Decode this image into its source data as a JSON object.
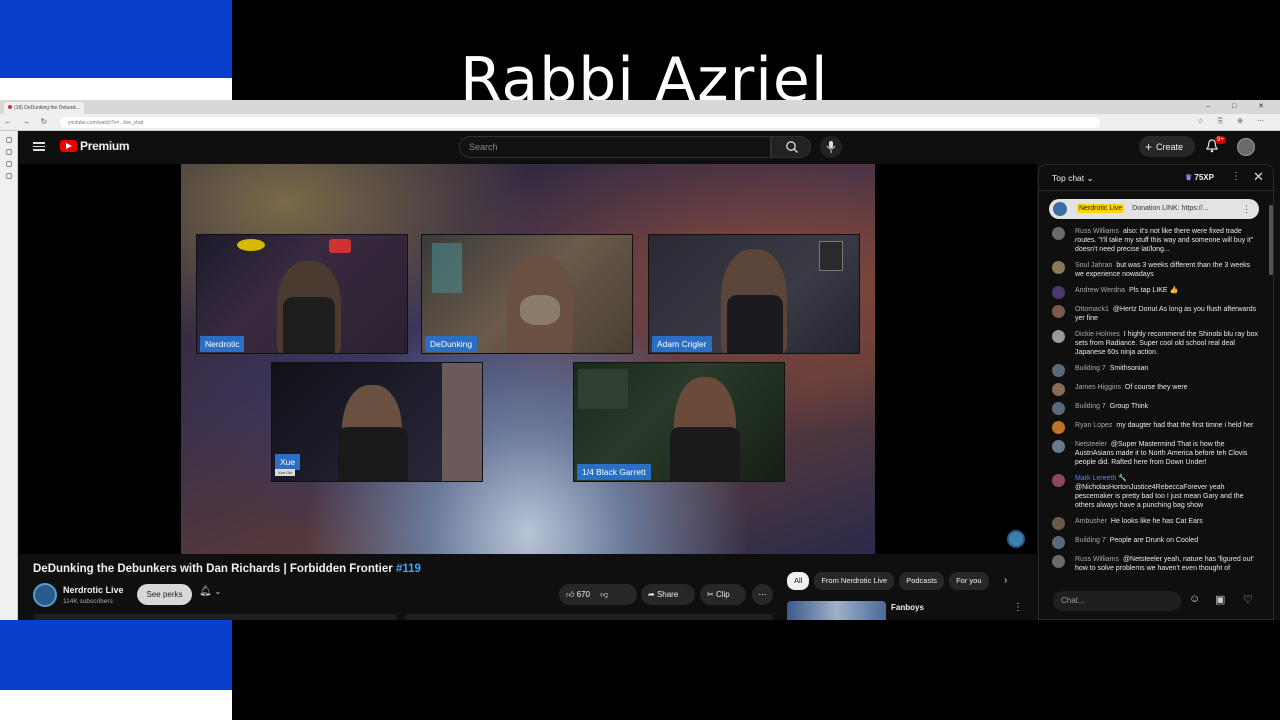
{
  "overlay": {
    "title": "Rabbi Azriel"
  },
  "browser": {
    "tab_title": "(18) DeDunking the Debunk...",
    "url": "youtube.com/watch?v=...live_chat",
    "nav_icons": "← → ↻",
    "toolbar_icons": "☆ ⎘ ⊕ ⋯",
    "window_controls": "– □ ✕"
  },
  "youtube": {
    "logo_text": "Premium",
    "search_placeholder": "Search",
    "create_label": "Create",
    "notification_badge": "9+"
  },
  "video": {
    "participants": [
      {
        "name": "Nerdrotic"
      },
      {
        "name": "DeDunking"
      },
      {
        "name": "Adam Crigler"
      },
      {
        "name": "Xue",
        "sub": "Xue Girl"
      },
      {
        "name": "1/4 Black Garrett"
      }
    ],
    "title_main": "DeDunking the Debunkers with Dan Richards | Forbidden Frontier ",
    "title_hashtag": "#119",
    "channel_name": "Nerdrotic Live",
    "subscribers": "114K subscribers",
    "perks_label": "See perks",
    "like_count": "670",
    "share_label": "Share",
    "clip_label": "Clip",
    "more_label": "⋯"
  },
  "recommendations": {
    "chips": [
      "All",
      "From Nerdrotic Live",
      "Podcasts",
      "For you"
    ],
    "first_title": "Fanboys"
  },
  "chat": {
    "mode_label": "Top chat ⌄",
    "xp": "75XP",
    "pinned_author": "Nerdrotic Live",
    "pinned_text": "Donation LINK: https://...",
    "input_placeholder": "Chat...",
    "messages": [
      {
        "author": "Russ Williams",
        "text": "also: it's not like there were fixed trade routes. \"I'll take my stuff this way and someone will buy it\" doesn't need precise lat/long...",
        "avatar_color": "#6a6a6a"
      },
      {
        "author": "Soul Jahran",
        "text": "but was 3 weeks different than the 3 weeks we experience nowadays",
        "avatar_color": "#8a7a5a"
      },
      {
        "author": "Andrew Werdna",
        "text": "Pls tap LIKE 👍",
        "avatar_color": "#4a3a6a"
      },
      {
        "author": "Ottomack1",
        "text": "@Hertz Donut As long as you flush afterwards yer fine",
        "avatar_color": "#7a5a4a"
      },
      {
        "author": "Dickie Holmes",
        "text": "I highly recommend the Shinobi blu ray box sets from Radiance. Super cool old school real deal Japanese 60s ninja action.",
        "avatar_color": "#9a9a9a"
      },
      {
        "author": "Building 7",
        "text": "Smithsonian",
        "avatar_color": "#5a6a7a"
      },
      {
        "author": "James Higgins",
        "text": "Of course they were",
        "avatar_color": "#8a6a5a"
      },
      {
        "author": "Building 7",
        "text": "Group Think",
        "avatar_color": "#5a6a7a"
      },
      {
        "author": "Ryan Lopez",
        "text": "my daugter had that the first timne i held her",
        "avatar_color": "#c0722a"
      },
      {
        "author": "Netsteeler",
        "text": "@Super Mastermind That is how the AustriAsians made it to North America before teh Clovis people did. Rafted here from Down Under!",
        "avatar_color": "#6a7a8a"
      },
      {
        "author": "Mark Lereeth 🔧",
        "text": "@NicholasHortonJustice4RebeccaForever yeah pescemaker is pretty bad too I just mean Gary and the others always have a punching bag show",
        "avatar_color": "#8a4a5a",
        "mod": true
      },
      {
        "author": "Ambusher",
        "text": "He looks like he has Cat Ears",
        "avatar_color": "#6a5a4a"
      },
      {
        "author": "Building 7",
        "text": "People are Drunk on Cooled",
        "avatar_color": "#5a6a7a"
      },
      {
        "author": "Russ Williams",
        "text": "@Netsteeler yeah, nature has 'figured out' how to solve problems we haven't even thought of",
        "avatar_color": "#6a6a6a"
      }
    ]
  }
}
